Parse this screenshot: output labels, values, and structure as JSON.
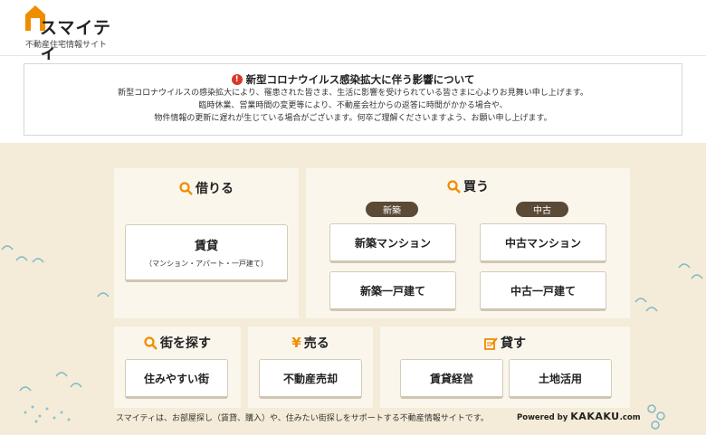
{
  "header": {
    "logo_text": "スマイティ",
    "logo_sub": "不動産住宅情報サイト"
  },
  "notice": {
    "title": "新型コロナウイルス感染拡大に伴う影響について",
    "lines": [
      "新型コロナウイルスの感染拡大により、罹患された皆さま、生活に影響を受けられている皆さまに心よりお見舞い申し上げます。",
      "臨時休業、営業時間の変更等により、不動産会社からの返答に時間がかかる場合や、",
      "物件情報の更新に遅れが生じている場合がございます。何卒ご理解くださいますよう、お願い申し上げます。"
    ]
  },
  "rent": {
    "title": "借りる",
    "button_label": "賃貸",
    "button_sub": "（マンション・アパート・一戸建て）"
  },
  "buy": {
    "title": "買う",
    "tag_new": "新築",
    "tag_used": "中古",
    "new_mansion": "新築マンション",
    "new_house": "新築一戸建て",
    "used_mansion": "中古マンション",
    "used_house": "中古一戸建て"
  },
  "town": {
    "title": "街を探す",
    "button_label": "住みやすい街"
  },
  "sell": {
    "icon": "¥",
    "title": "売る",
    "button_label": "不動産売却"
  },
  "lend": {
    "title": "貸す",
    "button_rental_mgmt": "賃貸経営",
    "button_land_use": "土地活用"
  },
  "footer": {
    "description": "スマイティは、お部屋探し（賃貸、購入）や、住みたい街探しをサポートする不動産情報サイトです。",
    "powered_by": "Powered by",
    "powered_brand": "KAKAKU",
    "powered_suffix": ".com"
  },
  "colors": {
    "accent": "#f08c00",
    "alert": "#d9372b",
    "tag_bg": "#5a4a36",
    "main_bg": "#f4ecd8",
    "panel_bg": "#faf6ec"
  }
}
